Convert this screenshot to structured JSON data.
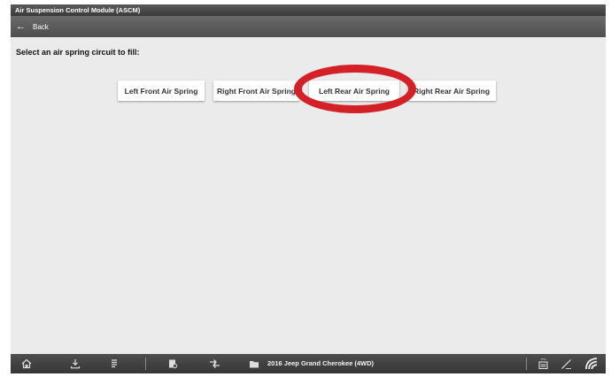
{
  "titlebar": {
    "title": "Air Suspension Control Module (ASCM)"
  },
  "backbar": {
    "back_label": "Back",
    "back_icon": "arrow-left-icon"
  },
  "main": {
    "prompt": "Select an air spring circuit to fill:",
    "buttons": [
      {
        "label": "Left Front Air Spring"
      },
      {
        "label": "Right Front Air Spring"
      },
      {
        "label": "Left Rear Air Spring",
        "highlighted": true
      },
      {
        "label": "Right Rear Air Spring"
      }
    ],
    "highlight_color": "#d42127"
  },
  "bottombar": {
    "vehicle": "2016 Jeep Grand Cherokee (4WD)",
    "icons": [
      "home-icon",
      "download-icon",
      "list-icon",
      "report-icon",
      "transfer-icon",
      "folder-icon",
      "vci-icon",
      "pen-icon",
      "wifi-icon"
    ]
  },
  "colors": {
    "toolbar": "#4e4e4e",
    "background": "#ebebeb",
    "button": "#ffffff"
  }
}
